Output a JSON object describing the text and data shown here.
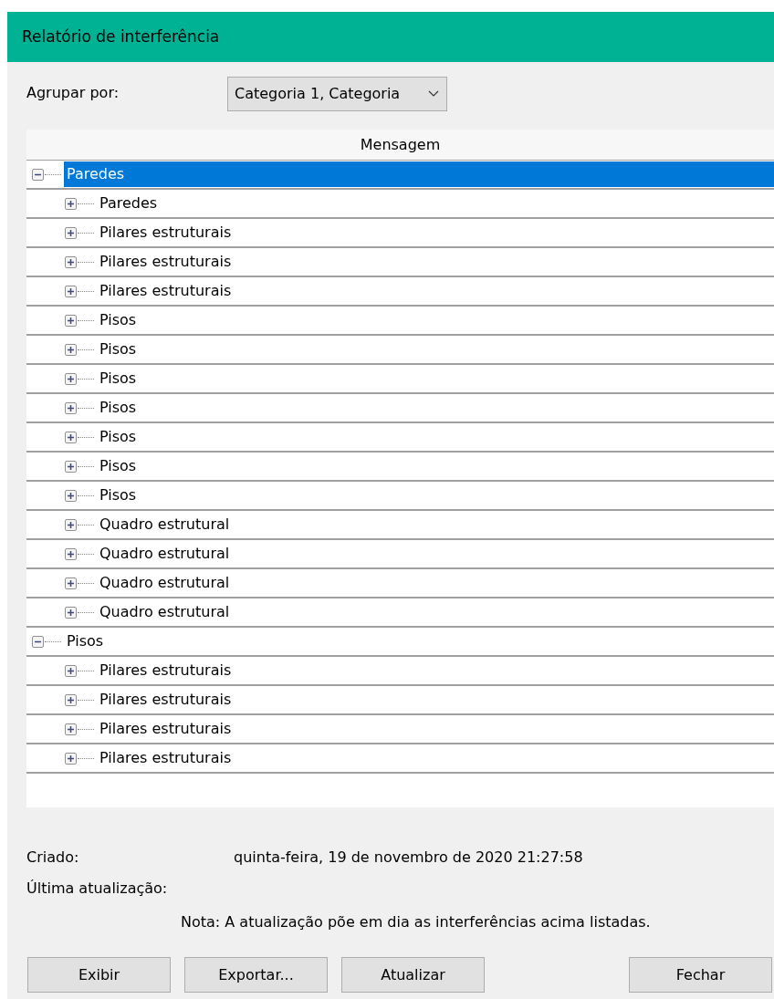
{
  "window": {
    "title": "Relatório de interferência"
  },
  "group_by": {
    "label": "Agrupar por:",
    "value": "Categoria 1, Categoria"
  },
  "tree": {
    "column": "Mensagem",
    "items": [
      {
        "label": "Paredes",
        "expanded": true,
        "selected": true,
        "children": [
          {
            "label": "Paredes",
            "expanded": false,
            "selected": false
          },
          {
            "label": "Pilares estruturais",
            "expanded": false,
            "selected": false
          },
          {
            "label": "Pilares estruturais",
            "expanded": false,
            "selected": false
          },
          {
            "label": "Pilares estruturais",
            "expanded": false,
            "selected": false
          },
          {
            "label": "Pisos",
            "expanded": false,
            "selected": false
          },
          {
            "label": "Pisos",
            "expanded": false,
            "selected": false
          },
          {
            "label": "Pisos",
            "expanded": false,
            "selected": false
          },
          {
            "label": "Pisos",
            "expanded": false,
            "selected": false
          },
          {
            "label": "Pisos",
            "expanded": false,
            "selected": false
          },
          {
            "label": "Pisos",
            "expanded": false,
            "selected": false
          },
          {
            "label": "Pisos",
            "expanded": false,
            "selected": false
          },
          {
            "label": "Quadro estrutural",
            "expanded": false,
            "selected": false
          },
          {
            "label": "Quadro estrutural",
            "expanded": false,
            "selected": false
          },
          {
            "label": "Quadro estrutural",
            "expanded": false,
            "selected": false
          },
          {
            "label": "Quadro estrutural",
            "expanded": false,
            "selected": false
          }
        ]
      },
      {
        "label": "Pisos",
        "expanded": true,
        "selected": false,
        "children": [
          {
            "label": "Pilares estruturais",
            "expanded": false,
            "selected": false
          },
          {
            "label": "Pilares estruturais",
            "expanded": false,
            "selected": false
          },
          {
            "label": "Pilares estruturais",
            "expanded": false,
            "selected": false
          },
          {
            "label": "Pilares estruturais",
            "expanded": false,
            "selected": false
          }
        ]
      }
    ]
  },
  "info": [
    {
      "label": "Criado:",
      "value": "quinta-feira, 19 de novembro de 2020 21:27:58"
    },
    {
      "label": "Última atualização:"
    }
  ],
  "note": "Nota: A atualização põe em dia as interferências acima listadas.",
  "buttons": [
    {
      "label": "Exibir",
      "kind": "left"
    },
    {
      "label": "Exportar...",
      "kind": "left"
    },
    {
      "label": "Atualizar",
      "kind": "left"
    },
    {
      "label": "Fechar",
      "kind": "right"
    }
  ]
}
